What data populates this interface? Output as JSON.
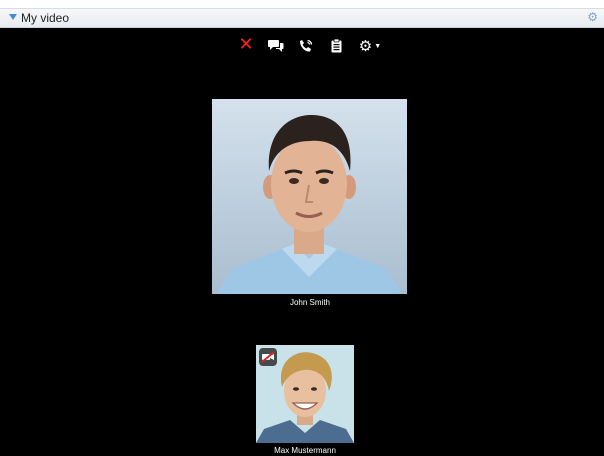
{
  "header": {
    "title": "My video"
  },
  "toolbar": {
    "icons": [
      "close-icon",
      "chat-icon",
      "phone-icon",
      "clipboard-icon",
      "gear-icon"
    ],
    "end_call_color": "#ff2020"
  },
  "participants": [
    {
      "name": "John Smith"
    },
    {
      "name": "Max Mustermann",
      "camera": "off"
    }
  ]
}
